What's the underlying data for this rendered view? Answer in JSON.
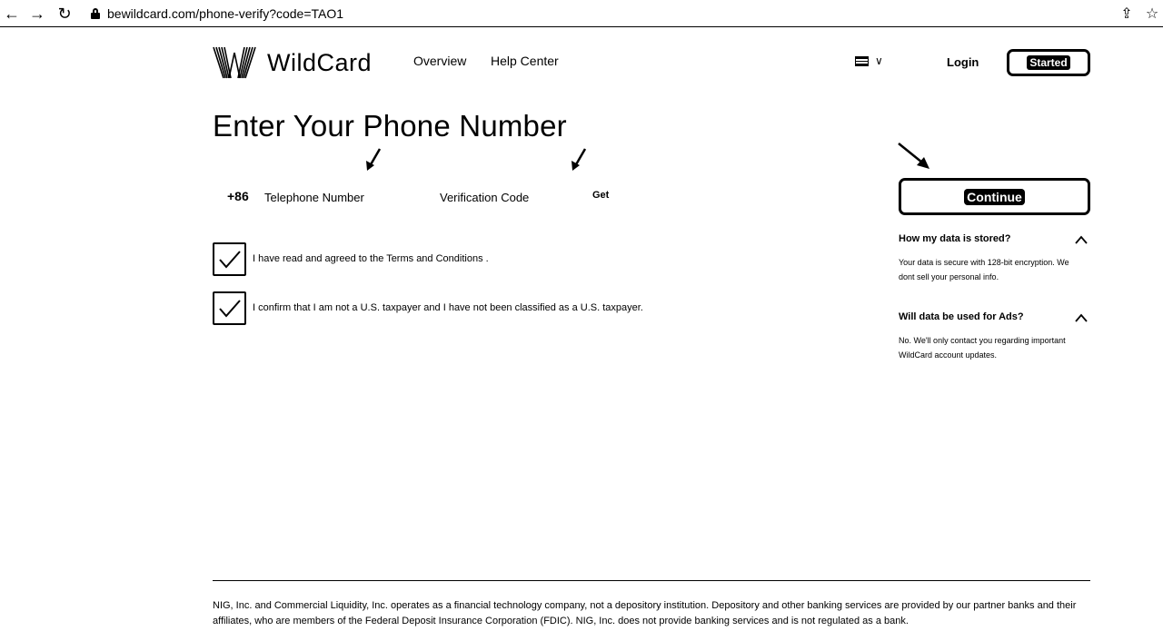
{
  "browser": {
    "url": "bewildcard.com/phone-verify?code=TAO1",
    "back_icon": "arrow-left-icon",
    "forward_icon": "arrow-right-icon",
    "reload_icon": "reload-icon",
    "share_icon": "share-icon",
    "bookmark_icon": "star-icon",
    "back_glyph": "←",
    "forward_glyph": "→",
    "reload_glyph": "↻",
    "share_glyph": "⇪",
    "bookmark_glyph": "☆"
  },
  "header": {
    "logo_text": "WildCard",
    "nav": [
      "Overview",
      "Help Center"
    ],
    "language_chevron": "∨",
    "login_label": "Login",
    "started_label": "Started"
  },
  "main": {
    "title": "Enter Your Phone Number",
    "country_code": "+86",
    "phone_placeholder": "Telephone Number",
    "code_placeholder": "Verification Code",
    "get_label": "Get",
    "checkboxes": [
      {
        "label": "I have read and agreed to the Terms and Conditions .",
        "checked": true
      },
      {
        "label": "I confirm that I am not a U.S. taxpayer and I have not been classified as a U.S. taxpayer.",
        "checked": true
      }
    ]
  },
  "sidebar": {
    "continue_label": "Continue",
    "faqs": [
      {
        "question": "How my data is stored?",
        "answer": "Your data is secure with 128-bit encryption. We dont sell your personal info."
      },
      {
        "question": "Will data be used for Ads?",
        "answer": "No. We'll only contact you regarding important WildCard account updates."
      }
    ]
  },
  "footer": {
    "disclaimer": "NIG, Inc. and Commercial Liquidity, Inc. operates as a financial technology company, not a depository institution. Depository and other banking services are provided by our partner banks and their affiliates, who are members of the Federal Deposit Insurance Corporation (FDIC). NIG, Inc. does not provide banking services and is not regulated as a bank."
  }
}
